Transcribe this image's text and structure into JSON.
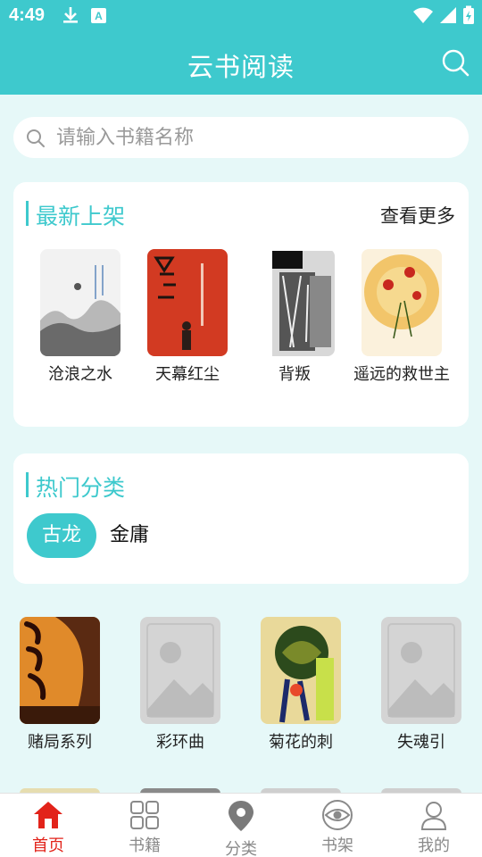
{
  "status_bar": {
    "time": "4:49"
  },
  "header": {
    "title": "云书阅读"
  },
  "search": {
    "placeholder": "请输入书籍名称"
  },
  "newest": {
    "title": "最新上架",
    "more_label": "查看更多",
    "books": [
      {
        "name": "沧浪之水"
      },
      {
        "name": "天幕红尘"
      },
      {
        "name": "背叛"
      },
      {
        "name": "遥远的救世主"
      }
    ]
  },
  "hot_categories": {
    "title": "热门分类",
    "tags": [
      {
        "label": "古龙",
        "active": true
      },
      {
        "label": "金庸",
        "active": false
      }
    ]
  },
  "category_books": [
    {
      "name": "赌局系列"
    },
    {
      "name": "彩环曲"
    },
    {
      "name": "菊花的刺"
    },
    {
      "name": "失魂引"
    }
  ],
  "tabs": [
    {
      "label": "首页",
      "icon": "home-icon"
    },
    {
      "label": "书籍",
      "icon": "grid-icon"
    },
    {
      "label": "分类",
      "icon": "location-pin-icon"
    },
    {
      "label": "书架",
      "icon": "eye-icon"
    },
    {
      "label": "我的",
      "icon": "user-icon"
    }
  ],
  "colors": {
    "accent": "#3ec9cd",
    "active_tab": "#e2231a",
    "background": "#e6f8f8"
  }
}
